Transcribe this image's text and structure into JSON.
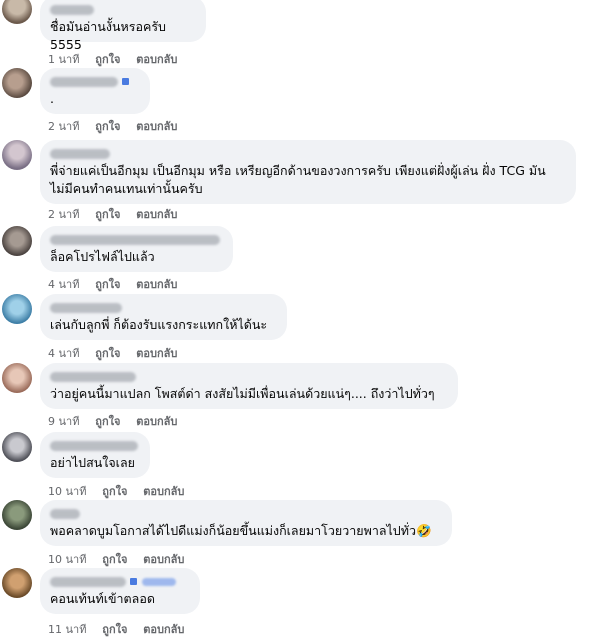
{
  "actions": {
    "like": "ถูกใจ",
    "reply": "ตอบกลับ"
  },
  "comments": [
    {
      "text": "ชื่อมันอ่านงั้นหรอครับ 5555",
      "time": "1 นาที"
    },
    {
      "text": ".",
      "time": "2 นาที"
    },
    {
      "text": "พี่จ่ายแค่เป็นอีกมุม เป็นอีกมุม หรือ เหรียญอีกด้านของวงการครับ เพียงแต่ฝั่งผู้เล่น ฝั่ง TCG มัน\nไม่มีคนทำคนเทนเท่านั้นครับ",
      "time": "2 นาที"
    },
    {
      "text": "ล็อคโปรไฟล์ไปแล้ว",
      "time": "4 นาที"
    },
    {
      "text": "เล่นกับลูกพี่ ก็ต้องรับแรงกระแทกให้ได้นะ",
      "time": "4 นาที"
    },
    {
      "text": "ว่าอยู่คนนี้มาแปลก โพสต์ด่า สงสัยไม่มีเพื่อนเล่นด้วยแน่ๆ.... ถึงว่าไปทั่วๆ",
      "time": "9 นาที"
    },
    {
      "text": "อย่าไปสนใจเลย",
      "time": "10 นาที"
    },
    {
      "text": "พอคลาดบูมโอกาสได้ไปดีแม่งก็น้อยขึ้นแม่งก็เลยมาโวยวายพาลไปทั่ว🤣",
      "time": "10 นาที"
    },
    {
      "text": "คอนเท้นท์เข้าตลอด",
      "time": "11 นาที"
    }
  ]
}
